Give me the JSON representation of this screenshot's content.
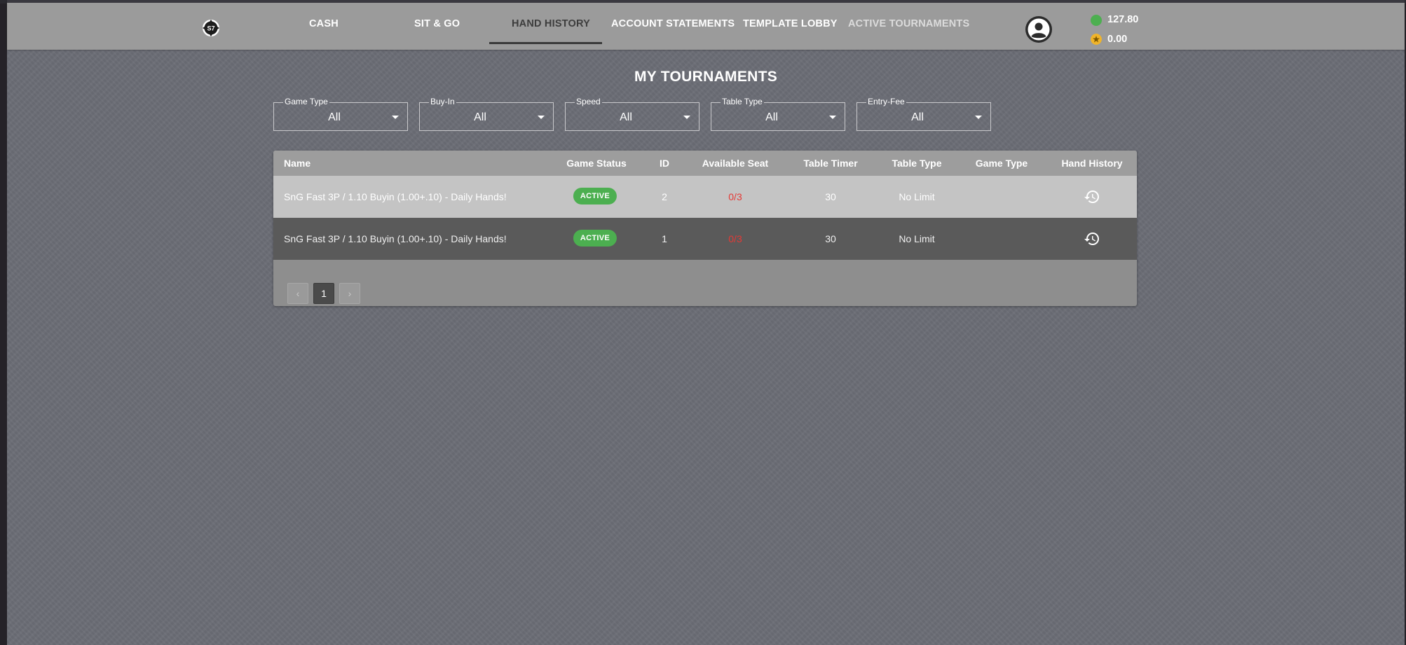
{
  "nav": {
    "items": [
      {
        "label": "CASH"
      },
      {
        "label": "SIT & GO"
      },
      {
        "label": "HAND HISTORY"
      },
      {
        "label": "ACCOUNT STATEMENTS"
      },
      {
        "label": "TEMPLATE LOBBY"
      },
      {
        "label": "ACTIVE TOURNAMENTS"
      }
    ],
    "active_item": "HAND HISTORY"
  },
  "balances": {
    "cash": "127.80",
    "points": "0.00"
  },
  "page_title": "MY TOURNAMENTS",
  "filters": [
    {
      "label": "Game Type",
      "value": "All"
    },
    {
      "label": "Buy-In",
      "value": "All"
    },
    {
      "label": "Speed",
      "value": "All"
    },
    {
      "label": "Table Type",
      "value": "All"
    },
    {
      "label": "Entry-Fee",
      "value": "All"
    }
  ],
  "table": {
    "columns": [
      "Name",
      "Game Status",
      "ID",
      "Available Seat",
      "Table Timer",
      "Table Type",
      "Game Type",
      "Hand History"
    ],
    "rows": [
      {
        "name": "SnG Fast 3P / 1.10 Buyin (1.00+.10) - Daily Hands!",
        "status": "ACTIVE",
        "id": "2",
        "seats": "0/3",
        "timer": "30",
        "table_type": "No Limit",
        "game_type": ""
      },
      {
        "name": "SnG Fast 3P / 1.10 Buyin (1.00+.10) - Daily Hands!",
        "status": "ACTIVE",
        "id": "1",
        "seats": "0/3",
        "timer": "30",
        "table_type": "No Limit",
        "game_type": ""
      }
    ]
  },
  "pagination": {
    "prev": "‹",
    "current": "1",
    "next": "›"
  },
  "colors": {
    "active_badge": "#4caf50",
    "seats_text": "#e53935",
    "header_bar": "#9b9b9b",
    "background": "#6b6d75"
  },
  "icons": {
    "logo": "poker-chip-logo-icon",
    "account": "user-circle-icon",
    "cash": "green-coin-icon",
    "points": "star-coin-icon",
    "hand_history": "history-icon",
    "dropdown": "caret-down-icon"
  }
}
